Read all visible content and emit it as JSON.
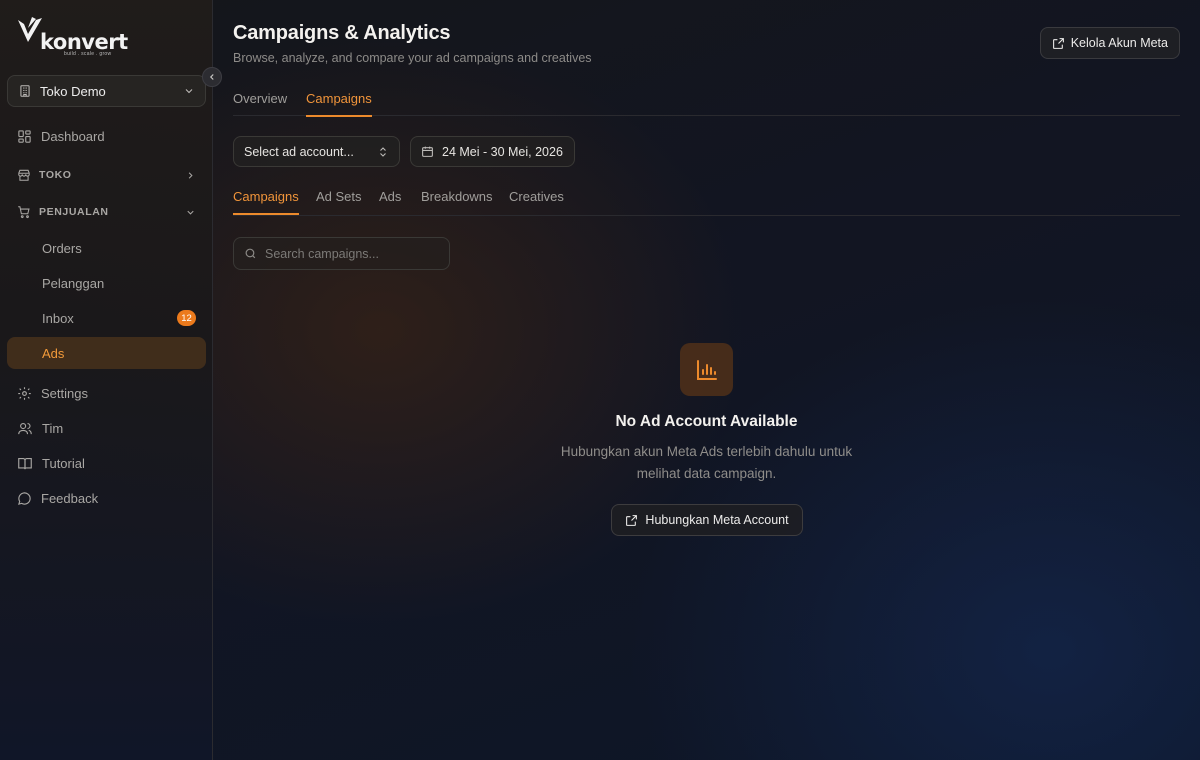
{
  "brand": {
    "name": "konvert",
    "tagline": "build . scale . grow"
  },
  "store": {
    "name": "Toko Demo"
  },
  "sidebar": {
    "dashboard": "Dashboard",
    "toko": "TOKO",
    "penjualan": "PENJUALAN",
    "orders": "Orders",
    "pelanggan": "Pelanggan",
    "inbox": "Inbox",
    "inbox_badge": "12",
    "ads": "Ads",
    "settings": "Settings",
    "tim": "Tim",
    "tutorial": "Tutorial",
    "feedback": "Feedback"
  },
  "header": {
    "title": "Campaigns & Analytics",
    "subtitle": "Browse, analyze, and compare your ad campaigns and creatives",
    "manage_button": "Kelola Akun Meta"
  },
  "top_tabs": [
    "Overview",
    "Campaigns"
  ],
  "filters": {
    "account_select": "Select ad account...",
    "date_range": "24 Mei - 30 Mei, 2026"
  },
  "sub_tabs": [
    "Campaigns",
    "Ad Sets",
    "Ads",
    "Breakdowns",
    "Creatives"
  ],
  "search": {
    "placeholder": "Search campaigns..."
  },
  "empty_state": {
    "title": "No Ad Account Available",
    "description": "Hubungkan akun Meta Ads terlebih dahulu untuk melihat data campaign.",
    "button": "Hubungkan Meta Account"
  },
  "colors": {
    "accent": "#ec8a2c",
    "badge": "#ec7a1c",
    "active_bg": "#4e341c"
  }
}
